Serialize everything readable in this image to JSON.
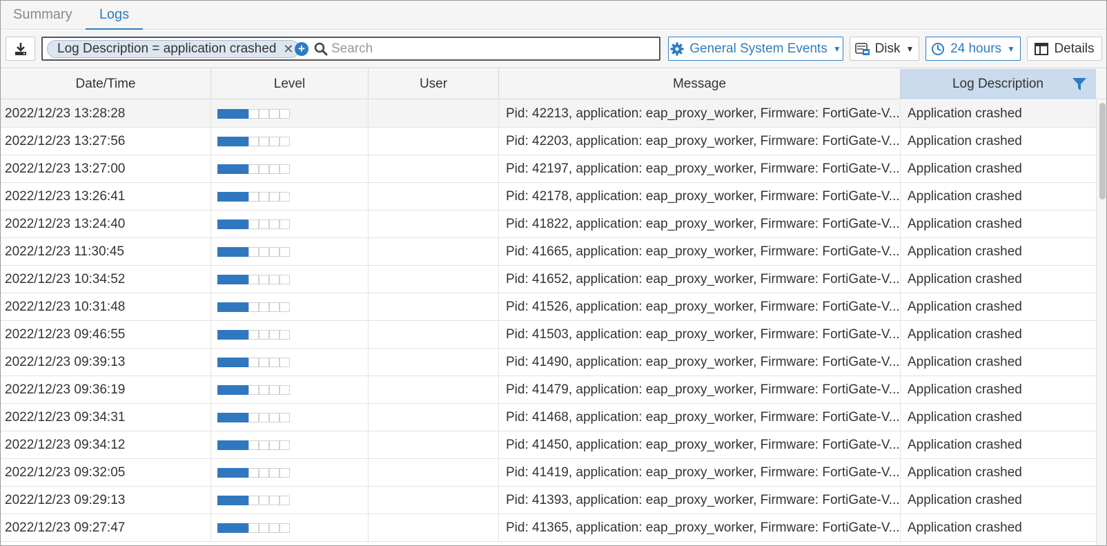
{
  "tabs": [
    {
      "label": "Summary",
      "active": false
    },
    {
      "label": "Logs",
      "active": true
    }
  ],
  "toolbar": {
    "download_icon": "download-icon",
    "filter_chip": "Log Description = application crashed",
    "search_placeholder": "Search",
    "event_type": "General System Events",
    "log_source": "Disk",
    "time_range": "24 hours",
    "details_label": "Details"
  },
  "table": {
    "columns": [
      "Date/Time",
      "Level",
      "User",
      "Message",
      "Log Description"
    ],
    "level_filled": 3,
    "level_total": 7,
    "rows": [
      {
        "datetime": "2022/12/23 13:28:28",
        "user": "",
        "message": "Pid: 42213, application: eap_proxy_worker, Firmware: FortiGate-V...",
        "description": "Application crashed"
      },
      {
        "datetime": "2022/12/23 13:27:56",
        "user": "",
        "message": "Pid: 42203, application: eap_proxy_worker, Firmware: FortiGate-V...",
        "description": "Application crashed"
      },
      {
        "datetime": "2022/12/23 13:27:00",
        "user": "",
        "message": "Pid: 42197, application: eap_proxy_worker, Firmware: FortiGate-V...",
        "description": "Application crashed"
      },
      {
        "datetime": "2022/12/23 13:26:41",
        "user": "",
        "message": "Pid: 42178, application: eap_proxy_worker, Firmware: FortiGate-V...",
        "description": "Application crashed"
      },
      {
        "datetime": "2022/12/23 13:24:40",
        "user": "",
        "message": "Pid: 41822, application: eap_proxy_worker, Firmware: FortiGate-V...",
        "description": "Application crashed"
      },
      {
        "datetime": "2022/12/23 11:30:45",
        "user": "",
        "message": "Pid: 41665, application: eap_proxy_worker, Firmware: FortiGate-V...",
        "description": "Application crashed"
      },
      {
        "datetime": "2022/12/23 10:34:52",
        "user": "",
        "message": "Pid: 41652, application: eap_proxy_worker, Firmware: FortiGate-V...",
        "description": "Application crashed"
      },
      {
        "datetime": "2022/12/23 10:31:48",
        "user": "",
        "message": "Pid: 41526, application: eap_proxy_worker, Firmware: FortiGate-V...",
        "description": "Application crashed"
      },
      {
        "datetime": "2022/12/23 09:46:55",
        "user": "",
        "message": "Pid: 41503, application: eap_proxy_worker, Firmware: FortiGate-V...",
        "description": "Application crashed"
      },
      {
        "datetime": "2022/12/23 09:39:13",
        "user": "",
        "message": "Pid: 41490, application: eap_proxy_worker, Firmware: FortiGate-V...",
        "description": "Application crashed"
      },
      {
        "datetime": "2022/12/23 09:36:19",
        "user": "",
        "message": "Pid: 41479, application: eap_proxy_worker, Firmware: FortiGate-V...",
        "description": "Application crashed"
      },
      {
        "datetime": "2022/12/23 09:34:31",
        "user": "",
        "message": "Pid: 41468, application: eap_proxy_worker, Firmware: FortiGate-V...",
        "description": "Application crashed"
      },
      {
        "datetime": "2022/12/23 09:34:12",
        "user": "",
        "message": "Pid: 41450, application: eap_proxy_worker, Firmware: FortiGate-V...",
        "description": "Application crashed"
      },
      {
        "datetime": "2022/12/23 09:32:05",
        "user": "",
        "message": "Pid: 41419, application: eap_proxy_worker, Firmware: FortiGate-V...",
        "description": "Application crashed"
      },
      {
        "datetime": "2022/12/23 09:29:13",
        "user": "",
        "message": "Pid: 41393, application: eap_proxy_worker, Firmware: FortiGate-V...",
        "description": "Application crashed"
      },
      {
        "datetime": "2022/12/23 09:27:47",
        "user": "",
        "message": "Pid: 41365, application: eap_proxy_worker, Firmware: FortiGate-V...",
        "description": "Application crashed"
      }
    ]
  },
  "colors": {
    "accent": "#2d7cc3",
    "level_fill": "#2f78bf",
    "selected_header": "#c9dbec"
  }
}
